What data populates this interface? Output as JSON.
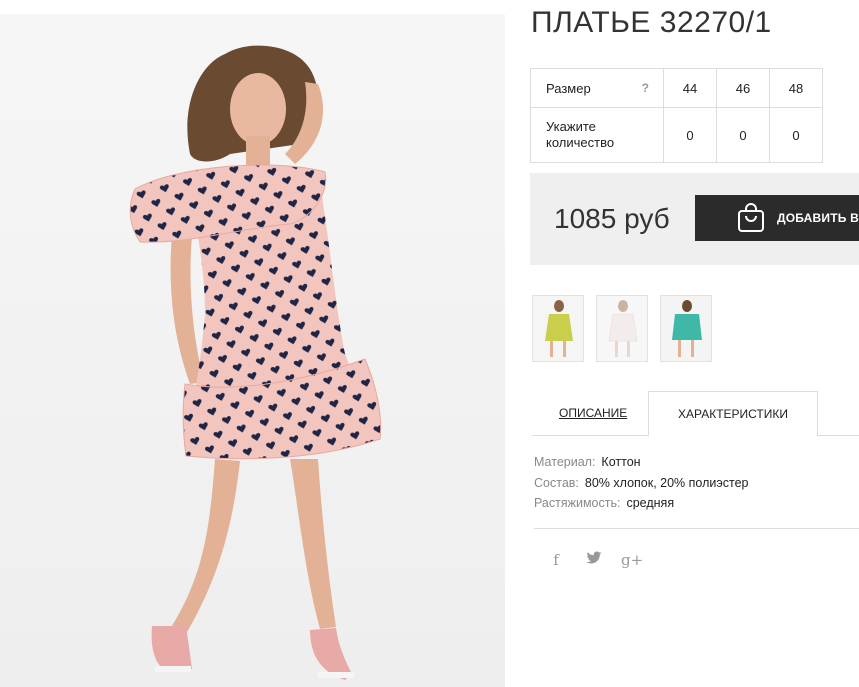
{
  "product": {
    "title": "ПЛАТЬЕ 32270/1",
    "price": "1085 руб",
    "add_to_cart": "ДОБАВИТЬ В КОРЗИНУ"
  },
  "size_table": {
    "size_label": "Размер",
    "help_label": "?",
    "qty_label": "Укажите количество",
    "sizes": [
      "44",
      "46",
      "48"
    ],
    "quantities": [
      "0",
      "0",
      "0"
    ]
  },
  "thumbnails": [
    {
      "color": "#c9cf4a"
    },
    {
      "color": "#f2ecea"
    },
    {
      "color": "#3fb8a8"
    }
  ],
  "tabs": {
    "description": "ОПИСАНИЕ",
    "characteristics": "ХАРАКТЕРИСТИКИ"
  },
  "characteristics": [
    {
      "key": "Материал:",
      "value": "Коттон"
    },
    {
      "key": "Состав:",
      "value": "80% хлопок, 20% полиэстер"
    },
    {
      "key": "Растяжимость:",
      "value": "средняя"
    }
  ],
  "social": {
    "facebook": "f",
    "twitter": "🐦",
    "googleplus": "g+"
  },
  "colors": {
    "dress_pink": "#f2c6bf",
    "heart_navy": "#1f2546",
    "button_dark": "#2b2b2b",
    "buy_box_bg": "#efefef"
  }
}
